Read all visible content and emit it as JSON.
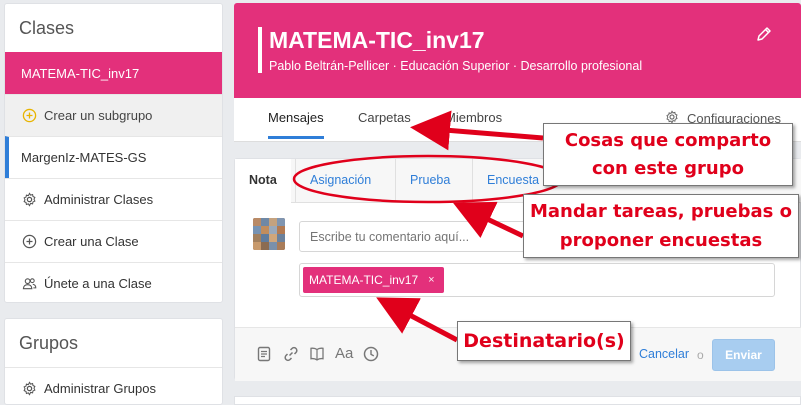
{
  "sidebar": {
    "heading": "Clases",
    "items": [
      {
        "label": "MATEMA-TIC_inv17"
      },
      {
        "label": "Crear un subgrupo"
      },
      {
        "label": "MargenIz-MATES-GS"
      },
      {
        "label": "Administrar Clases"
      },
      {
        "label": "Crear una Clase"
      },
      {
        "label": "Únete a una Clase"
      }
    ],
    "groups_heading": "Grupos",
    "groups_items": [
      {
        "label": "Administrar Grupos"
      }
    ]
  },
  "header": {
    "title": "MATEMA-TIC_inv17",
    "subtitle": "Pablo Beltrán-Pellicer · Educación Superior · Desarrollo profesional",
    "color": "#e3307b"
  },
  "tabs": {
    "items": [
      {
        "label": "Mensajes"
      },
      {
        "label": "Carpetas"
      },
      {
        "label": "Miembros"
      }
    ],
    "settings_label": "Configuraciones",
    "active_color": "#2f7ed8"
  },
  "composer": {
    "tabs": [
      {
        "label": "Nota"
      },
      {
        "label": "Asignación"
      },
      {
        "label": "Prueba"
      },
      {
        "label": "Encuesta"
      }
    ],
    "comment_placeholder": "Escribe tu comentario aquí...",
    "recipient_chip": "MATEMA-TIC_inv17",
    "recipient_remove": "×",
    "cancel_label": "Cancelar",
    "or_label": "o",
    "send_label": "Enviar"
  },
  "annotations": {
    "share": [
      "Cosas que comparto",
      "con este grupo"
    ],
    "assign": [
      "Mandar tareas, pruebas o",
      "proponer encuestas"
    ],
    "recipients": "Destinatario(s)",
    "color": "#e0001b"
  }
}
